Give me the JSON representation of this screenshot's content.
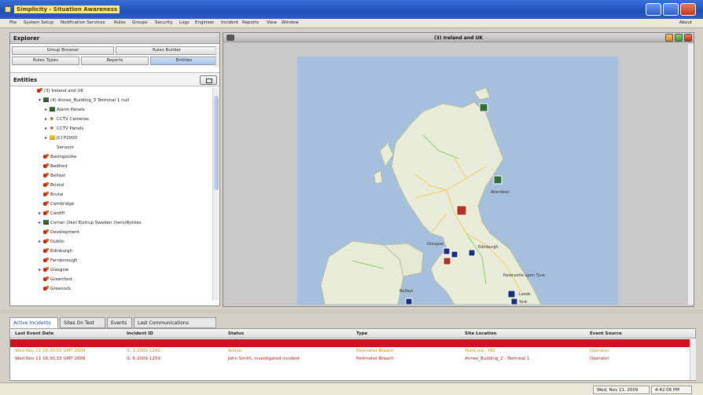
{
  "window": {
    "title": "Simplicity - Situation Awareness"
  },
  "menu": {
    "items": [
      "File",
      "System Setup",
      "Notification Services",
      "Rules",
      "Groups",
      "Security",
      "Logs",
      "Engineer",
      "Incident",
      "Reports",
      "View",
      "Window"
    ],
    "about": "About"
  },
  "explorer": {
    "title": "Explorer",
    "tabs_top": [
      "Group Browser",
      "Rules Builder"
    ],
    "tabs_bottom": [
      "Rules Types",
      "Reports",
      "Entities"
    ],
    "active_tab": "Entities",
    "entities_label": "Entities",
    "tree": [
      {
        "label": "(3) Ireland and UK",
        "icon": "site-red-icon",
        "expander": "",
        "level": 0
      },
      {
        "label": "(4) Annex_Building_3 Terminal 1 null",
        "icon": "building-icon",
        "expander": "▾",
        "level": 1
      },
      {
        "label": "Alarm Panels",
        "icon": "alarm-panel-icon",
        "expander": "▸",
        "level": 2
      },
      {
        "label": "CCTV Cameras",
        "icon": "cctv-icon",
        "expander": "▸",
        "level": 2
      },
      {
        "label": "CCTV Panels",
        "icon": "cctv-icon",
        "expander": "▸",
        "level": 2
      },
      {
        "label": "JCI P2000",
        "icon": "lock-icon",
        "expander": "▸",
        "level": 2
      },
      {
        "label": "Sensors",
        "icon": "sensor-icon",
        "expander": "",
        "level": 2
      },
      {
        "label": "Basingstoke",
        "icon": "site-red-icon",
        "expander": "",
        "level": 1
      },
      {
        "label": "Bedford",
        "icon": "site-red-icon",
        "expander": "",
        "level": 1
      },
      {
        "label": "Belfast",
        "icon": "site-red-icon",
        "expander": "",
        "level": 1
      },
      {
        "label": "Bristol",
        "icon": "site-red-icon",
        "expander": "",
        "level": 1
      },
      {
        "label": "Brutal",
        "icon": "site-red-icon",
        "expander": "",
        "level": 1
      },
      {
        "label": "Cambridge",
        "icon": "site-red-icon",
        "expander": "",
        "level": 1
      },
      {
        "label": "Cardiff",
        "icon": "site-red-icon",
        "expander": "▸",
        "level": 1
      },
      {
        "label": "Corner (like) Ejstrup Sweden (hers)Rykkes",
        "icon": "building-icon",
        "expander": "▸",
        "level": 1
      },
      {
        "label": "Development",
        "icon": "site-red-icon",
        "expander": "",
        "level": 1
      },
      {
        "label": "Dublin",
        "icon": "site-red-icon",
        "expander": "▸",
        "level": 1
      },
      {
        "label": "Edinburgh",
        "icon": "site-red-icon",
        "expander": "",
        "level": 1
      },
      {
        "label": "Farnborough",
        "icon": "site-red-icon",
        "expander": "",
        "level": 1
      },
      {
        "label": "Glasgow",
        "icon": "site-red-icon",
        "expander": "▸",
        "level": 1
      },
      {
        "label": "Greenford",
        "icon": "site-red-icon",
        "expander": "",
        "level": 1
      },
      {
        "label": "Greenock",
        "icon": "site-red-icon",
        "expander": "",
        "level": 1
      }
    ]
  },
  "map": {
    "title": "(3) Ireland and UK",
    "labels": [
      "Aberdeen",
      "Edinburgh",
      "Newcastle upon Tyne",
      "Belfast",
      "Glasgow",
      "Leeds",
      "York"
    ]
  },
  "bottom_tabs": [
    "Active Incidents",
    "Sites On Test",
    "Events",
    "Last Communications"
  ],
  "incidents": {
    "columns": [
      "Last Event Date",
      "Incident ID",
      "Status",
      "Type",
      "Site Location",
      "Event Source"
    ],
    "rows": [
      [
        "",
        "",
        "",
        "",
        "",
        ""
      ],
      [
        "Wed Nov 11 16:30:53 GMT 2009",
        "IC-3-2009-1290",
        "Active",
        "Perimeter Breach",
        "TrunCore - HQ",
        "Operator"
      ],
      [
        "Wed Nov 11 16:30:33 GMT 2009",
        "IC-5-2009-1259",
        "John Smith, investigated incident",
        "Perimeter Breach",
        "Annex_Building_2 - Terminal 1",
        "Operator"
      ]
    ]
  },
  "status": {
    "date": "Wed, Nov 11, 2009",
    "time": "4:42:06 PM"
  },
  "colors": {
    "incident_highlight": "#c8141e",
    "titlebar": "#2a5cc4"
  }
}
